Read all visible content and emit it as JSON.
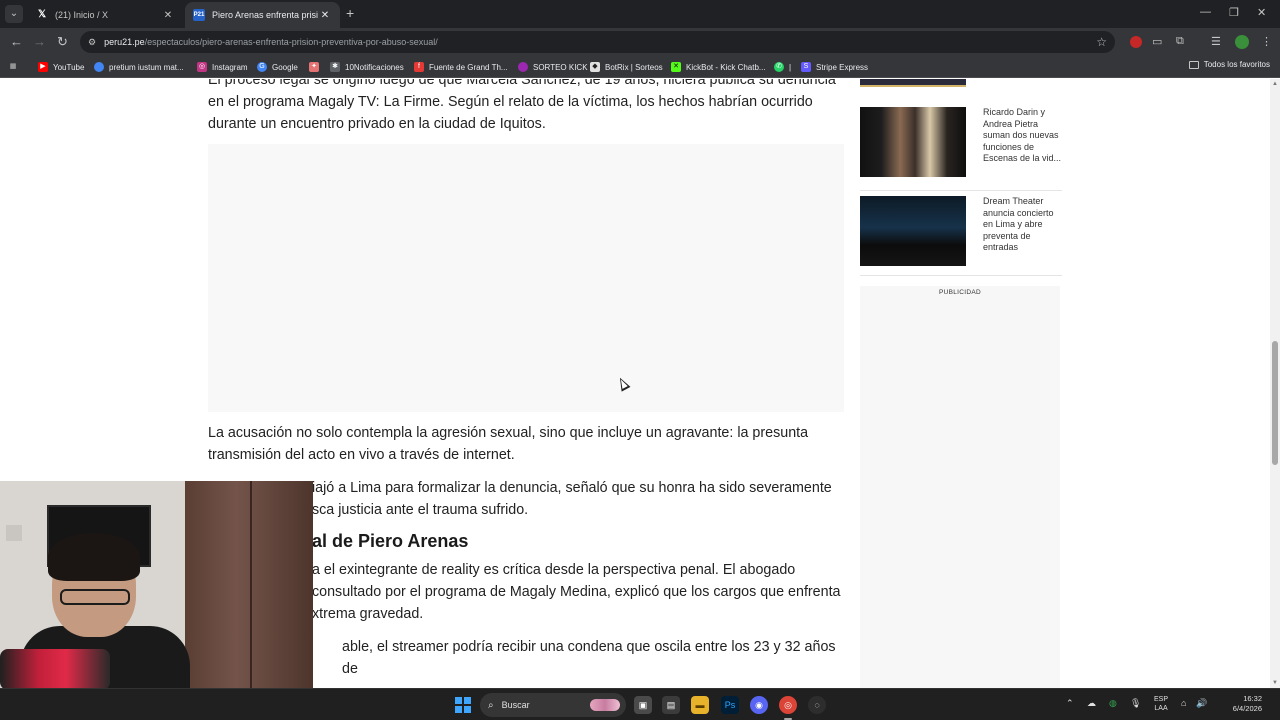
{
  "browser": {
    "tabs": [
      {
        "title": "(21) Inicio / X",
        "icon": "x-logo-icon",
        "active": false
      },
      {
        "title": "Piero Arenas enfrenta prisión p",
        "icon": "peru21-favicon-icon",
        "active": true
      }
    ],
    "url": {
      "domain": "peru21.pe",
      "path": "/espectaculos/piero-arenas-enfrenta-prision-preventiva-por-abuso-sexual/"
    },
    "bookmarks": [
      {
        "label": "YouTube",
        "icon": "youtube-icon",
        "color": "#ff0000"
      },
      {
        "label": "pretium iustum mat...",
        "icon": "chrome-icon",
        "color": "#4285f4"
      },
      {
        "label": "Instagram",
        "icon": "instagram-icon",
        "color": "#c13584"
      },
      {
        "label": "Google",
        "icon": "google-icon",
        "color": "#4285f4"
      },
      {
        "label": "",
        "icon": "puzzle-piece-icon",
        "color": "#e57373"
      },
      {
        "label": "10Notificaciones",
        "icon": "notification-icon",
        "color": "#5f6368"
      },
      {
        "label": "Fuente de Grand Th...",
        "icon": "fandom-icon",
        "color": "#e53935"
      },
      {
        "label": "SORTEO KICK",
        "icon": "kick-icon",
        "color": "#9c27b0"
      },
      {
        "label": "BotRix | Sorteos",
        "icon": "botrix-icon",
        "color": "#e0e0e0"
      },
      {
        "label": "KickBot - Kick Chatb...",
        "icon": "kickbot-icon",
        "color": "#53fc18"
      },
      {
        "label": "|",
        "icon": "whatsapp-icon",
        "color": "#25d366"
      },
      {
        "label": "Stripe Express",
        "icon": "stripe-icon",
        "color": "#635bff"
      }
    ],
    "bookmarks_all": "Todos los favoritos"
  },
  "article": {
    "paragraph_1": "El proceso legal se originó luego de que Marcela Sánchez, de 19 años, hiciera pública su denuncia en el programa Magaly TV: La Firme. Según el relato de la víctima, los hechos habrían ocurrido durante un encuentro privado en la ciudad de Iquitos.",
    "paragraph_2": "La acusación no solo contempla la agresión sexual, sino que incluye un agravante: la presunta transmisión del acto en vivo a través de internet.",
    "paragraph_3": "iajó a Lima para formalizar la denuncia, señaló que su honra ha sido severamente sca justicia ante el trauma sufrido.",
    "heading": "al de Piero Arenas",
    "paragraph_4": "a el exintegrante de reality es crítica desde la perspectiva penal. El abogado consultado por el programa de Magaly Medina, explicó que los cargos que enfrenta xtrema gravedad.",
    "paragraph_5": "able, el streamer podría recibir una condena que oscila entre los 23 y 32 años de"
  },
  "sidebar": {
    "items": [
      {
        "caption": "Ricardo Darin y Andrea Pietra suman dos nuevas funciones de Escenas de la vid..."
      },
      {
        "caption": "Dream Theater anuncia concierto en Lima y abre preventa de entradas"
      }
    ],
    "ad_label": "PUBLICIDAD"
  },
  "taskbar": {
    "search_placeholder": "Buscar",
    "lang_top": "ESP",
    "lang_bottom": "LAA",
    "time": "16:32",
    "date": "6/4/2026"
  }
}
